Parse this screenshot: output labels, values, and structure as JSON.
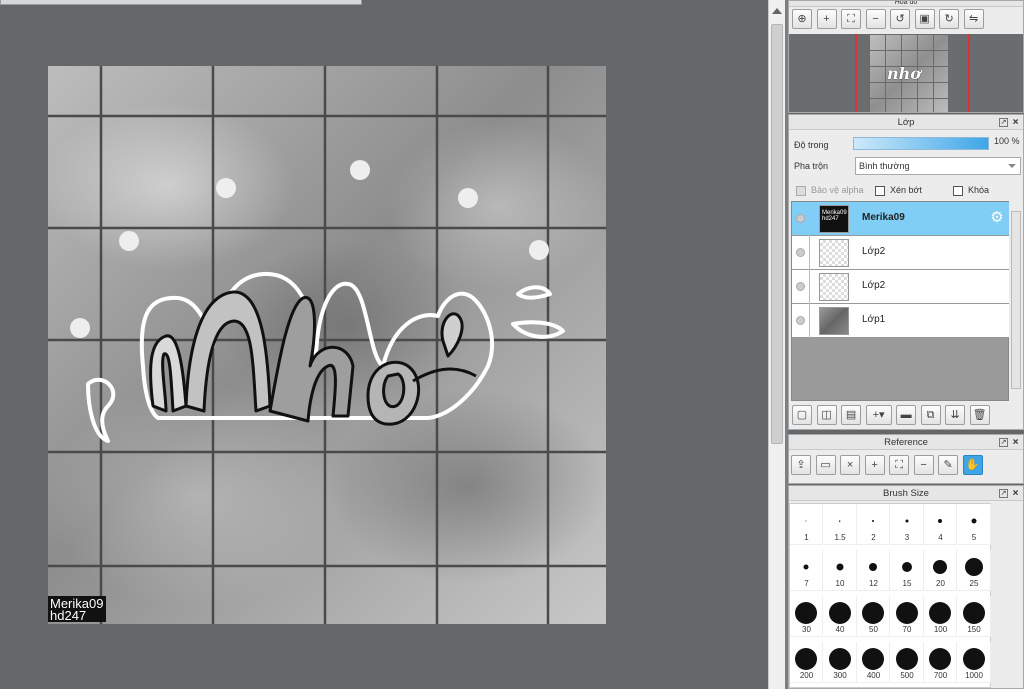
{
  "canvas": {
    "watermark_line1": "Merika09",
    "watermark_line2": "hd247",
    "grid_color": "#4a4a4a"
  },
  "navigator": {
    "title": "Hoa đồ",
    "tools": [
      "zoom-reset-icon",
      "zoom-in-icon",
      "fit-icon",
      "zoom-out-icon",
      "rotate-left-icon",
      "fit-screen-icon",
      "rotate-right-icon",
      "flip-icon"
    ]
  },
  "layer_panel": {
    "title": "Lớp",
    "opacity_label": "Độ trong",
    "opacity_value": "100 %",
    "opacity_percent": 100,
    "blend_label": "Pha trộn",
    "blend_value": "Bình thường",
    "protect_alpha_label": "Bảo vệ alpha",
    "clipping_label": "Xén bớt",
    "lock_label": "Khóa",
    "layers": [
      {
        "name": "Merika09",
        "thumb_text": "Merika09 hd247",
        "selected": true
      },
      {
        "name": "Lớp2",
        "selected": false
      },
      {
        "name": "Lớp2",
        "selected": false
      },
      {
        "name": "Lớp1",
        "selected": false
      }
    ]
  },
  "reference_panel": {
    "title": "Reference"
  },
  "brush_panel": {
    "title": "Brush Size",
    "sizes": [
      "1",
      "1.5",
      "2",
      "3",
      "4",
      "5",
      "7",
      "10",
      "12",
      "15",
      "20",
      "25",
      "30",
      "40",
      "50",
      "70",
      "100",
      "150",
      "200",
      "300",
      "400",
      "500",
      "700",
      "1000"
    ]
  },
  "colors": {
    "accent": "#3ea6e6",
    "selected_layer": "#80cdf5",
    "canvas_bg": "#65686b"
  }
}
